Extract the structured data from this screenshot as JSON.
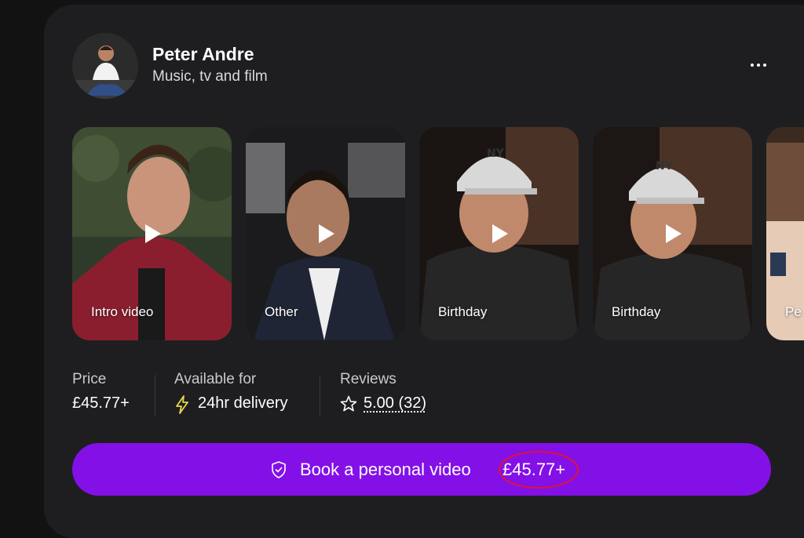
{
  "profile": {
    "name": "Peter Andre",
    "category": "Music, tv and film",
    "avatar_icon": "person-photo",
    "more_icon": "more-dots-icon"
  },
  "videos": [
    {
      "label": "Intro video"
    },
    {
      "label": "Other"
    },
    {
      "label": "Birthday"
    },
    {
      "label": "Birthday"
    },
    {
      "label": "Pe"
    }
  ],
  "stats": {
    "price_label": "Price",
    "price_value": "£45.77+",
    "availability_label": "Available for",
    "availability_value": "24hr delivery",
    "reviews_label": "Reviews",
    "reviews_value": "5.00 (32)"
  },
  "cta": {
    "label": "Book a personal video",
    "price": "£45.77+",
    "icon": "shield-check-icon"
  },
  "colors": {
    "background": "#121212",
    "card": "#1e1e21",
    "accent": "#8410e8",
    "annotation": "#e0142e",
    "lightning": "#e7d74a"
  }
}
